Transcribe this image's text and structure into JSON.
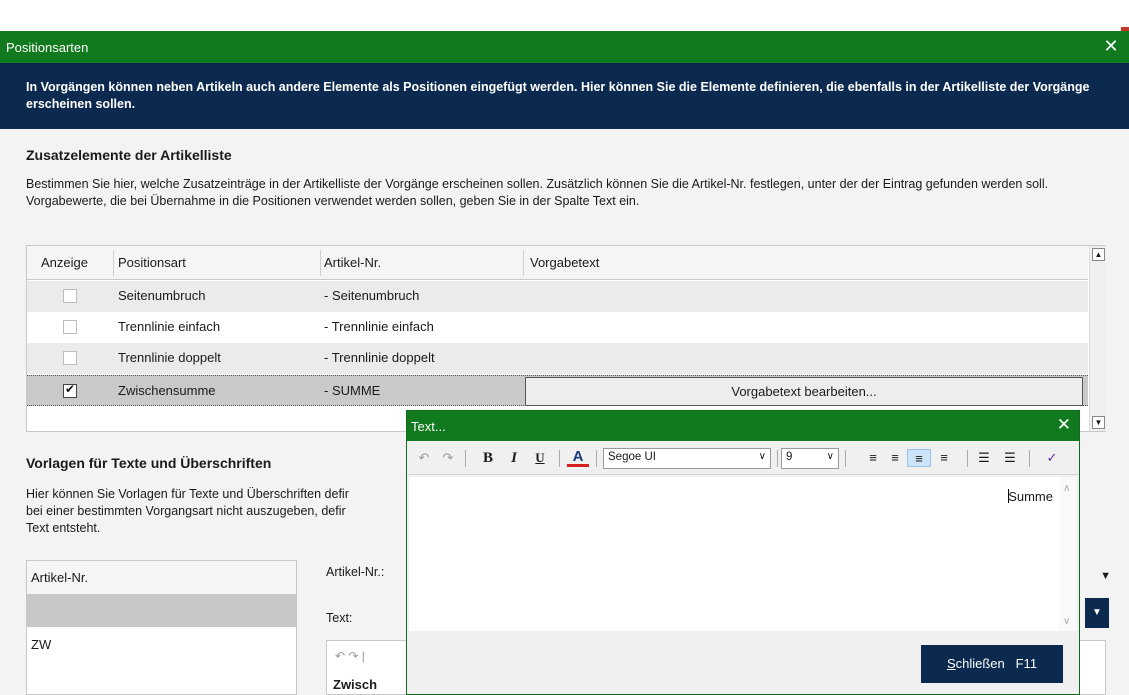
{
  "window": {
    "title": "Positionsarten",
    "close": "✕",
    "banner": "In Vorgängen können neben Artikeln auch andere Elemente als Positionen eingefügt werden. Hier können Sie die Elemente definieren, die ebenfalls in der Artikelliste der Vorgänge erscheinen sollen."
  },
  "section1": {
    "title": "Zusatzelemente der Artikelliste",
    "description": "Bestimmen Sie hier, welche Zusatzeinträge in der Artikelliste der Vorgänge erscheinen sollen. Zusätzlich können Sie die Artikel-Nr. festlegen, unter der der Eintrag gefunden werden soll. Vorgabewerte, die bei Übernahme in die Positionen verwendet werden sollen, geben Sie in der Spalte Text ein."
  },
  "grid": {
    "columns": [
      "Anzeige",
      "Positionsart",
      "Artikel-Nr.",
      "Vorgabetext"
    ],
    "rows": [
      {
        "checked": false,
        "positionsart": "Seitenumbruch",
        "artikel": "- Seitenumbruch"
      },
      {
        "checked": false,
        "positionsart": "Trennlinie einfach",
        "artikel": "- Trennlinie einfach"
      },
      {
        "checked": false,
        "positionsart": "Trennlinie doppelt",
        "artikel": "- Trennlinie doppelt"
      },
      {
        "checked": true,
        "positionsart": "Zwischensumme",
        "artikel": "- SUMME"
      }
    ],
    "edit_button": "Vorgabetext bearbeiten..."
  },
  "section2": {
    "title": "Vorlagen für Texte und Überschriften",
    "line1": "Hier können Sie Vorlagen für Texte und Überschriften defir",
    "line2": "bei einer bestimmten Vorgangsart nicht auszugeben, defir",
    "line3": "Text entsteht.",
    "list_header": "Artikel-Nr.",
    "list_item": "ZW",
    "artikel_label": "Artikel-Nr.:",
    "text_label": "Text:",
    "editor_stub": "Zwisch"
  },
  "text_dialog": {
    "title": "Text...",
    "close": "✕",
    "font": "Segoe UI",
    "size": "9",
    "content": "Summe",
    "close_button_prefix": "S",
    "close_button_rest": "chließen",
    "close_button_shortcut": "F11"
  }
}
